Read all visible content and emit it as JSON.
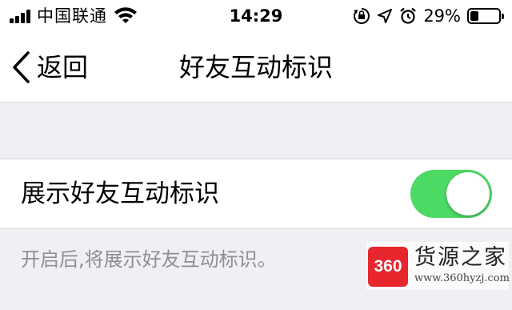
{
  "status_bar": {
    "carrier": "中国联通",
    "time": "14:29",
    "battery_percent": "29%",
    "battery_level": 0.29,
    "icons": [
      "signal-icon",
      "wifi-icon",
      "orientation-lock-icon",
      "location-icon",
      "alarm-icon",
      "battery-icon"
    ]
  },
  "nav": {
    "back_label": "返回",
    "title": "好友互动标识"
  },
  "setting": {
    "label": "展示好友互动标识",
    "enabled": true,
    "toggle_color": "#4cd964"
  },
  "footer": {
    "description": "开启后,将展示好友互动标识。"
  },
  "watermark": {
    "logo_text": "360",
    "name": "货源之家",
    "url": "www.360hyzj.com"
  }
}
